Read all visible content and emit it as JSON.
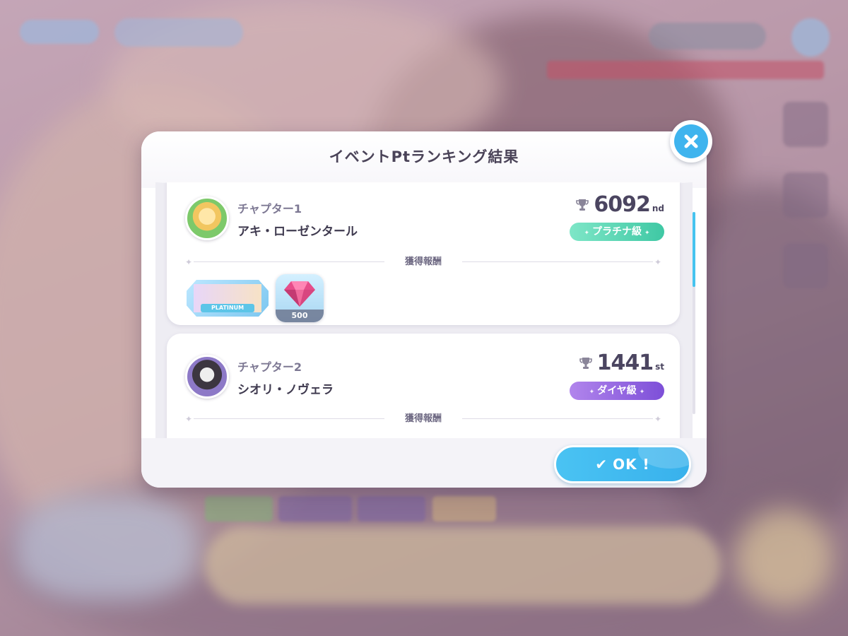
{
  "modal": {
    "title": "イベントPtランキング結果",
    "ok_label": "OK !",
    "divider_label": "獲得報酬"
  },
  "icons": {
    "close": "close-x-icon",
    "ok_check": "checkmark-icon",
    "trophy": "trophy-icon",
    "gem": "gem-icon"
  },
  "entries": [
    {
      "chapter": "チャプター1",
      "name": "アキ・ローゼンタール",
      "rank_number": "6092",
      "rank_suffix": "nd",
      "rank_class": "プラチナ級",
      "rank_class_color": "#4fcfae",
      "rewards": [
        {
          "type": "frame",
          "label": "PLATINUM"
        },
        {
          "type": "gem",
          "quantity": "500"
        }
      ]
    },
    {
      "chapter": "チャプター2",
      "name": "シオリ・ノヴェラ",
      "rank_number": "1441",
      "rank_suffix": "st",
      "rank_class": "ダイヤ級",
      "rank_class_color": "#8a5ce0"
    }
  ],
  "colors": {
    "accent": "#3fb4ee",
    "title_text": "#4a4358"
  }
}
